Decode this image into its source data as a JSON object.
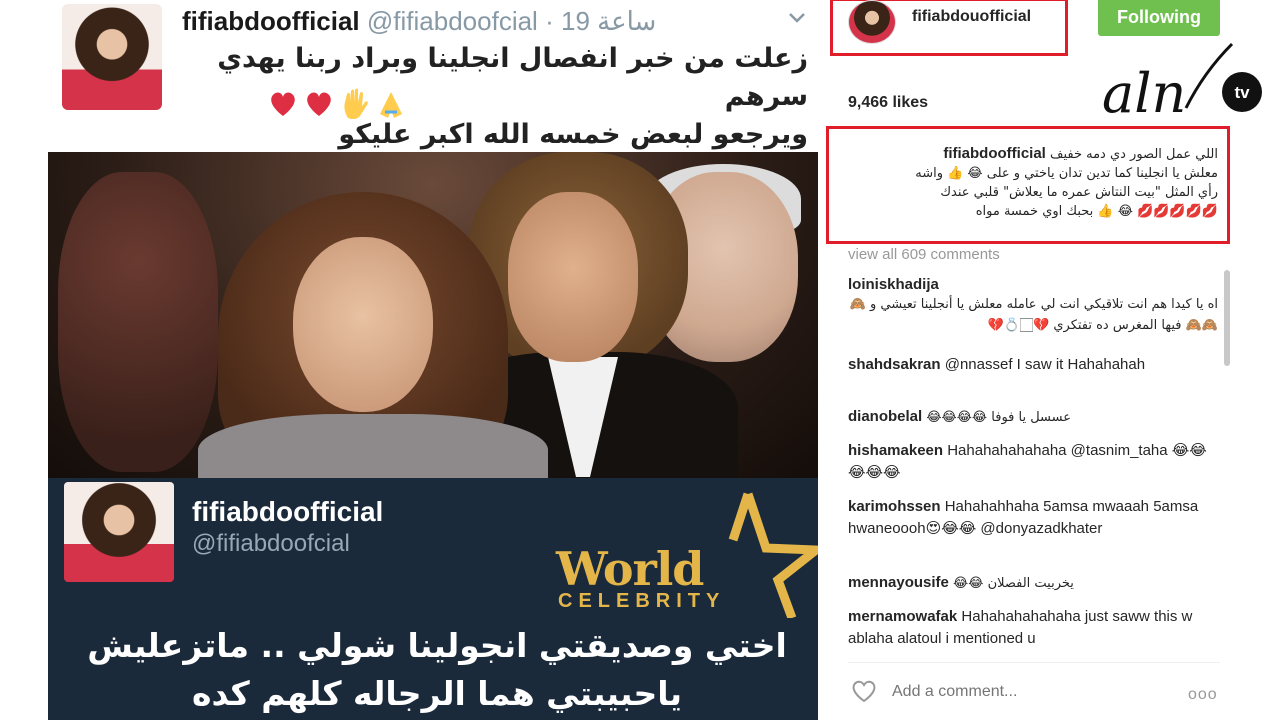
{
  "tweet": {
    "name": "fifiabdoofficial",
    "handle": "@fifiabdoofcial",
    "dot": "·",
    "time": "19 ساعة",
    "text_line1": "زعلت من خبر انفصال انجلينا وبراد ربنا يهدي سرهم",
    "text_line2": "ويرجعو لبعض خمسه الله اكبر عليكو",
    "emojis": [
      "heart",
      "heart",
      "raised-hand",
      "folded-hands"
    ],
    "card": {
      "name": "fifiabdoofficial",
      "handle": "@fifiabdoofcial",
      "logo_line1": "World",
      "logo_line2": "CELEBRITY",
      "text_line1": "اختي وصديقتي انجولينا شولي .. ماتزعليش",
      "text_line2": "ياحبيبتي هما الرجاله كلهم كده"
    }
  },
  "instagram": {
    "username": "fifiabdouofficial",
    "follow_label": "Following",
    "likes": "9,466 likes",
    "caption": {
      "user": "fifiabdoofficial",
      "text_line1": "اللي عمل الصور دي دمه خفيف",
      "text_line2": "معلش يا انجلينا كما تدين تدان ياختي و على 😂 👍 واشه",
      "text_line3": "رأي المثل \"بيت النتاش عمره ما يعلاش\" قلبي عندك",
      "text_line4": "💋💋💋💋💋 😂 👍 بحبك اوي خمسة مواه"
    },
    "view_all": "view all 609 comments",
    "comments": [
      {
        "user": "loiniskhadija",
        "text": "اه يا كيدا هم انت تلاقيكي انت لي عامله معلش يا أنجلينا تعيشي و 🙈🙈🙈 فيها المغرس ده تفتكري 💔🏻💍💔"
      },
      {
        "user": "shahdsakran",
        "text": "@nnassef I saw it Hahahahah"
      },
      {
        "user": "dianobelal",
        "text": "😂😂😂😂 عسسل يا فوفا"
      },
      {
        "user": "hishamakeen",
        "text": "Hahahahahahaha @tasnim_taha 😂😂😂😂😂"
      },
      {
        "user": "karimohssen",
        "text": "Hahahahhaha 5amsa mwaaah 5amsa hwaneoooh😍😂😂 @donyazadkhater"
      },
      {
        "user": "mennayousife",
        "text": "😂😂 يخربيت الفصلان"
      },
      {
        "user": "mernamowafak",
        "text": "Hahahahahahaha just saww this w ablaha alatoul i mentioned u"
      }
    ],
    "add_comment_placeholder": "Add a comment...",
    "more_label": "ooo"
  },
  "watermark": {
    "text": "aln",
    "badge": "tv"
  },
  "colors": {
    "follow_green": "#70c050",
    "highlight_red": "#e01e2a",
    "card_navy": "#1a2a3b",
    "logo_gold": "#e4b64a"
  }
}
